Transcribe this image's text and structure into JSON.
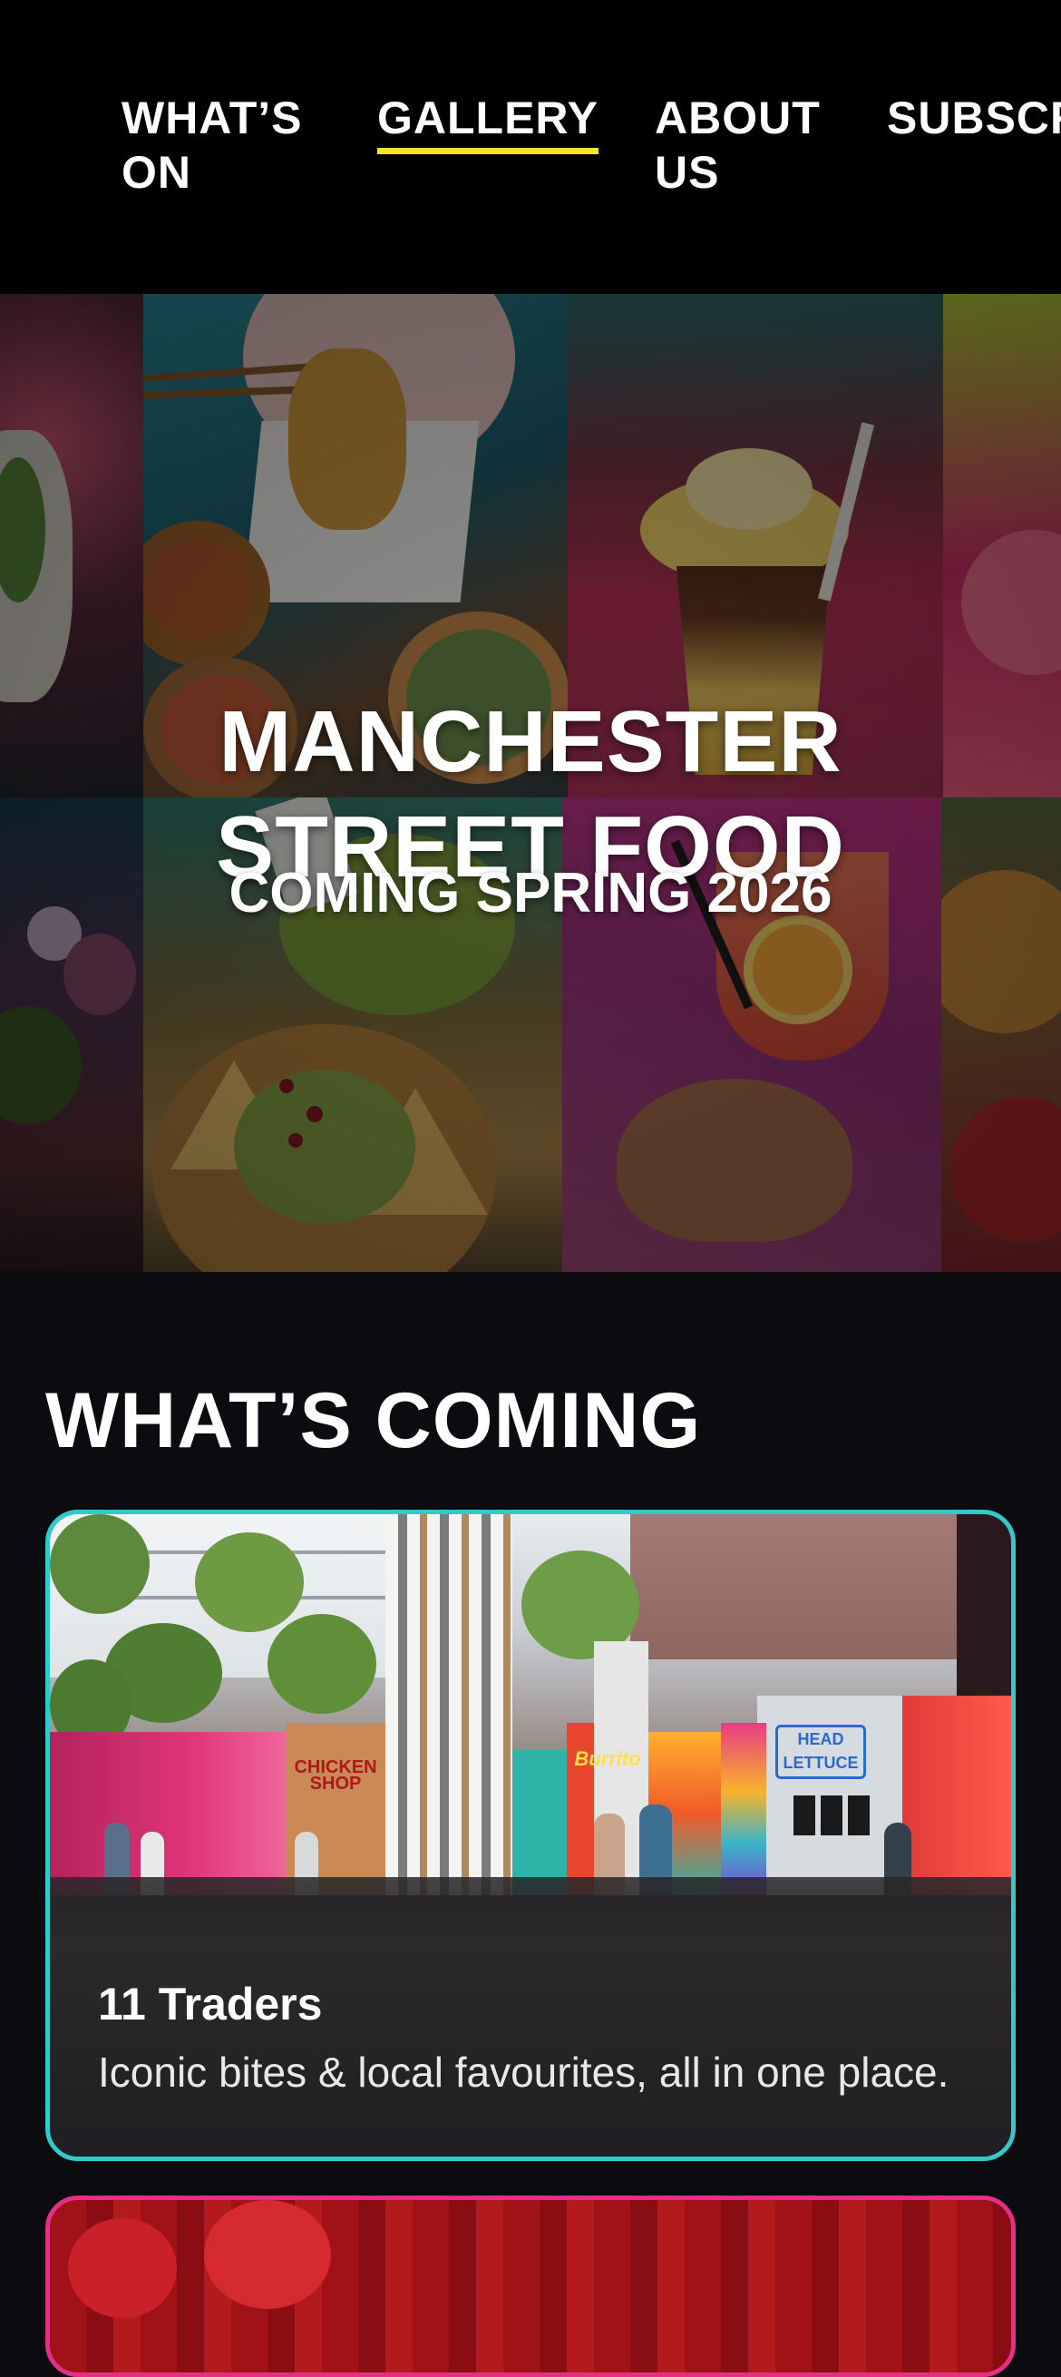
{
  "nav": {
    "items": [
      {
        "label": "WHAT’S\nON",
        "active": false
      },
      {
        "label": "GALLERY",
        "active": true
      },
      {
        "label": "ABOUT\nUS",
        "active": false
      },
      {
        "label": "SUBSCRIBE",
        "active": false
      }
    ],
    "active_underline_color": "#f6e22f"
  },
  "hero": {
    "title": "MANCHESTER\nSTREET FOOD",
    "subtitle": "COMING SPRING 2026"
  },
  "section": {
    "title": "WHAT’S COMING"
  },
  "cards": [
    {
      "heading": "11 Traders",
      "description": "Iconic bites & local favourites, all in one place.",
      "border_color": "#2fcac9",
      "signs": [
        "Burrito",
        "HEAD LETTUCE",
        "CHICKEN SHOP"
      ]
    },
    {
      "border_color": "#e52e86"
    }
  ],
  "colors": {
    "background": "#0c0b10",
    "nav_background": "#000000",
    "accent_yellow": "#f6e22f",
    "accent_teal": "#2fcac9",
    "accent_pink": "#e52e86"
  }
}
